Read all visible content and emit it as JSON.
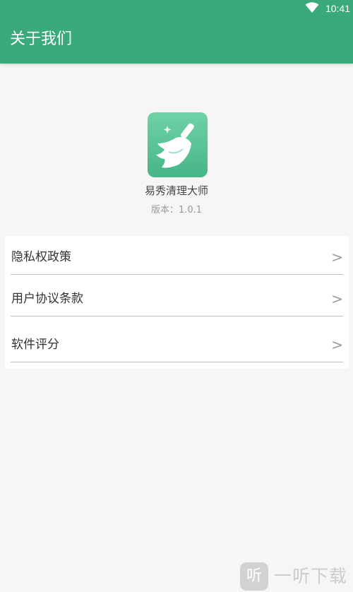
{
  "status_bar": {
    "time": "10:41",
    "wifi_icon": "wifi-icon"
  },
  "app_bar": {
    "title": "关于我们",
    "background_color": "#3aaa7a"
  },
  "app_info": {
    "icon": "broom-icon",
    "name": "易秀清理大师",
    "version": "版本：1.0.1"
  },
  "menu": {
    "items": [
      {
        "label": "隐私权政策",
        "chevron": ">"
      },
      {
        "label": "用户协议条款",
        "chevron": ">"
      },
      {
        "label": "软件评分",
        "chevron": ">"
      }
    ]
  },
  "watermark": {
    "badge": "听",
    "text": "一听下载"
  }
}
